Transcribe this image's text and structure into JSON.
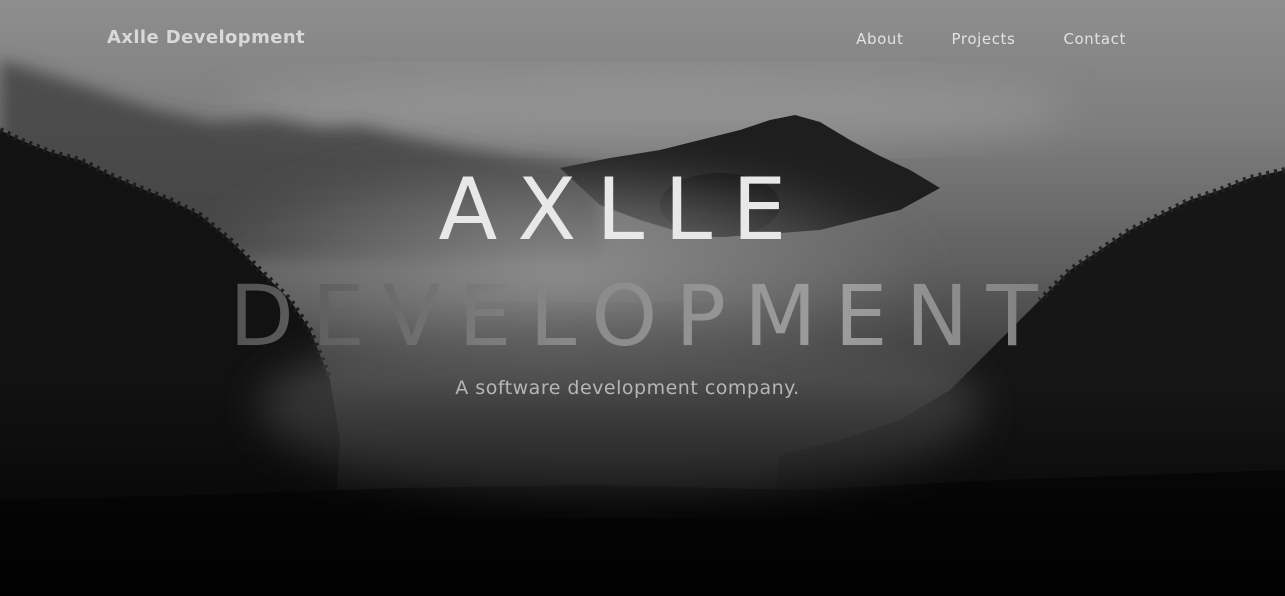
{
  "nav": {
    "brand": "Axlle Development",
    "links": [
      {
        "label": "About"
      },
      {
        "label": "Projects"
      },
      {
        "label": "Contact"
      }
    ]
  },
  "hero": {
    "title_line1": "AXLLE",
    "title_line2": "DEVELOPMENT",
    "subtitle": "A software development company.",
    "background": "misty-forest-mountains-grayscale-photo"
  },
  "colors": {
    "brand_text": "#d9d9d9",
    "nav_text": "#e2e2e2",
    "title_text": "#e8e8e8",
    "subtitle_text": "#b6b6b6"
  }
}
